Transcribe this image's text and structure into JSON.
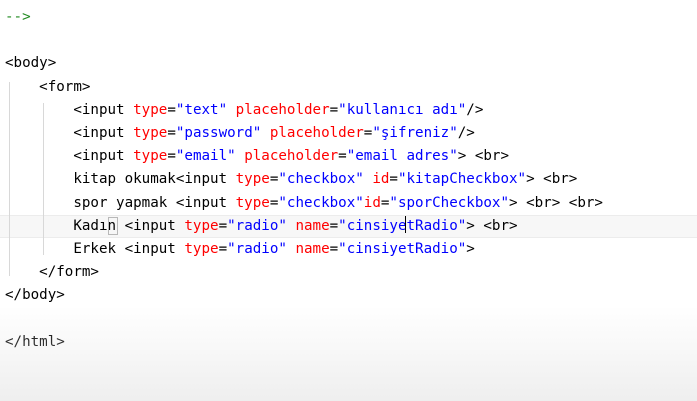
{
  "editor": {
    "colors": {
      "comment": "#228b22",
      "text": "#000000",
      "tag": "#800000",
      "attribute": "#ff0000",
      "value": "#0000ff",
      "background": "#ffffff"
    },
    "lines": [
      {
        "indent": "",
        "tokens": [
          {
            "t": "-->",
            "c": "comment"
          }
        ]
      },
      {
        "indent": "",
        "tokens": []
      },
      {
        "indent": "",
        "tokens": [
          {
            "t": "<body>",
            "c": "text"
          }
        ]
      },
      {
        "indent": "    ",
        "tokens": [
          {
            "t": "<form>",
            "c": "text"
          }
        ]
      },
      {
        "indent": "        ",
        "tokens": [
          {
            "t": "<input ",
            "c": "text"
          },
          {
            "t": "type",
            "c": "attribute"
          },
          {
            "t": "=",
            "c": "text"
          },
          {
            "t": "\"text\"",
            "c": "value"
          },
          {
            "t": " ",
            "c": "text"
          },
          {
            "t": "placeholder",
            "c": "attribute"
          },
          {
            "t": "=",
            "c": "text"
          },
          {
            "t": "\"kullanıcı adı\"",
            "c": "value"
          },
          {
            "t": "/>",
            "c": "text"
          }
        ]
      },
      {
        "indent": "        ",
        "tokens": [
          {
            "t": "<input ",
            "c": "text"
          },
          {
            "t": "type",
            "c": "attribute"
          },
          {
            "t": "=",
            "c": "text"
          },
          {
            "t": "\"password\"",
            "c": "value"
          },
          {
            "t": " ",
            "c": "text"
          },
          {
            "t": "placeholder",
            "c": "attribute"
          },
          {
            "t": "=",
            "c": "text"
          },
          {
            "t": "\"şifreniz\"",
            "c": "value"
          },
          {
            "t": "/>",
            "c": "text"
          }
        ]
      },
      {
        "indent": "        ",
        "tokens": [
          {
            "t": "<input ",
            "c": "text"
          },
          {
            "t": "type",
            "c": "attribute"
          },
          {
            "t": "=",
            "c": "text"
          },
          {
            "t": "\"email\"",
            "c": "value"
          },
          {
            "t": " ",
            "c": "text"
          },
          {
            "t": "placeholder",
            "c": "attribute"
          },
          {
            "t": "=",
            "c": "text"
          },
          {
            "t": "\"email adres\"",
            "c": "value"
          },
          {
            "t": "> <br>",
            "c": "text"
          }
        ]
      },
      {
        "indent": "        ",
        "tokens": [
          {
            "t": "kitap okumak",
            "c": "text"
          },
          {
            "t": "<input ",
            "c": "text"
          },
          {
            "t": "type",
            "c": "attribute"
          },
          {
            "t": "=",
            "c": "text"
          },
          {
            "t": "\"checkbox\"",
            "c": "value"
          },
          {
            "t": " ",
            "c": "text"
          },
          {
            "t": "id",
            "c": "attribute"
          },
          {
            "t": "=",
            "c": "text"
          },
          {
            "t": "\"kitapCheckbox\"",
            "c": "value"
          },
          {
            "t": "> <br>",
            "c": "text"
          }
        ]
      },
      {
        "indent": "        ",
        "tokens": [
          {
            "t": "spor yapmak ",
            "c": "text"
          },
          {
            "t": "<input ",
            "c": "text"
          },
          {
            "t": "type",
            "c": "attribute"
          },
          {
            "t": "=",
            "c": "text"
          },
          {
            "t": "\"checkbox\"",
            "c": "value"
          },
          {
            "t": "id",
            "c": "attribute"
          },
          {
            "t": "=",
            "c": "text"
          },
          {
            "t": "\"sporCheckbox\"",
            "c": "value"
          },
          {
            "t": "> <br> <br>",
            "c": "text"
          }
        ]
      },
      {
        "indent": "        ",
        "tokens": [
          {
            "t": "Kadın ",
            "c": "text"
          },
          {
            "t": "<input ",
            "c": "text"
          },
          {
            "t": "type",
            "c": "attribute"
          },
          {
            "t": "=",
            "c": "text"
          },
          {
            "t": "\"radio\"",
            "c": "value"
          },
          {
            "t": " ",
            "c": "text"
          },
          {
            "t": "name",
            "c": "attribute"
          },
          {
            "t": "=",
            "c": "text"
          },
          {
            "t": "\"cinsiyetRadio\"",
            "c": "value"
          },
          {
            "t": "> <br>",
            "c": "text"
          }
        ]
      },
      {
        "indent": "        ",
        "tokens": [
          {
            "t": "Erkek ",
            "c": "text"
          },
          {
            "t": "<input ",
            "c": "text"
          },
          {
            "t": "type",
            "c": "attribute"
          },
          {
            "t": "=",
            "c": "text"
          },
          {
            "t": "\"radio\"",
            "c": "value"
          },
          {
            "t": " ",
            "c": "text"
          },
          {
            "t": "name",
            "c": "attribute"
          },
          {
            "t": "=",
            "c": "text"
          },
          {
            "t": "\"cinsiyetRadio\"",
            "c": "value"
          },
          {
            "t": ">",
            "c": "text"
          }
        ]
      },
      {
        "indent": "    ",
        "tokens": [
          {
            "t": "</form>",
            "c": "text"
          }
        ]
      },
      {
        "indent": "",
        "tokens": [
          {
            "t": "</body>",
            "c": "text"
          }
        ]
      },
      {
        "indent": "",
        "tokens": []
      },
      {
        "indent": "",
        "tokens": [
          {
            "t": "</html>",
            "c": "text"
          }
        ]
      }
    ]
  }
}
